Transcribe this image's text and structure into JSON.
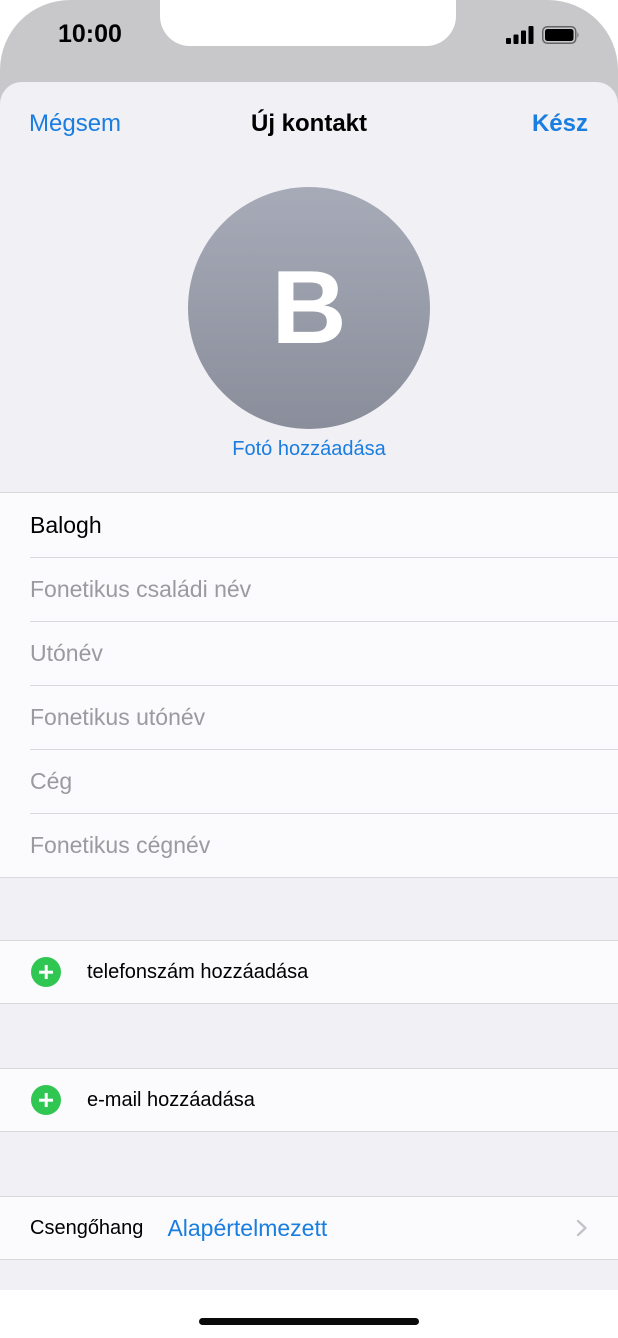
{
  "status_bar": {
    "time": "10:00",
    "signal_icon": "cellular-signal-icon",
    "battery_icon": "battery-icon"
  },
  "nav": {
    "cancel_label": "Mégsem",
    "title": "Új kontakt",
    "done_label": "Kész"
  },
  "avatar": {
    "initial": "B",
    "add_photo_label": "Fotó hozzáadása"
  },
  "name_fields": [
    {
      "value": "Balogh",
      "placeholder": ""
    },
    {
      "value": "",
      "placeholder": "Fonetikus családi név"
    },
    {
      "value": "",
      "placeholder": "Utónév"
    },
    {
      "value": "",
      "placeholder": "Fonetikus utónév"
    },
    {
      "value": "",
      "placeholder": "Cég"
    },
    {
      "value": "",
      "placeholder": "Fonetikus cégnév"
    }
  ],
  "add_phone": {
    "label": "telefonszám hozzáadása",
    "icon": "add-circle-icon"
  },
  "add_email": {
    "label": "e-mail hozzáadása",
    "icon": "add-circle-icon"
  },
  "ringtone": {
    "label": "Csengőhang",
    "value": "Alapértelmezett",
    "icon": "chevron-right-icon"
  },
  "colors": {
    "accent": "#1a7de0",
    "add_green": "#2fc652",
    "background": "#f0f0f5"
  }
}
